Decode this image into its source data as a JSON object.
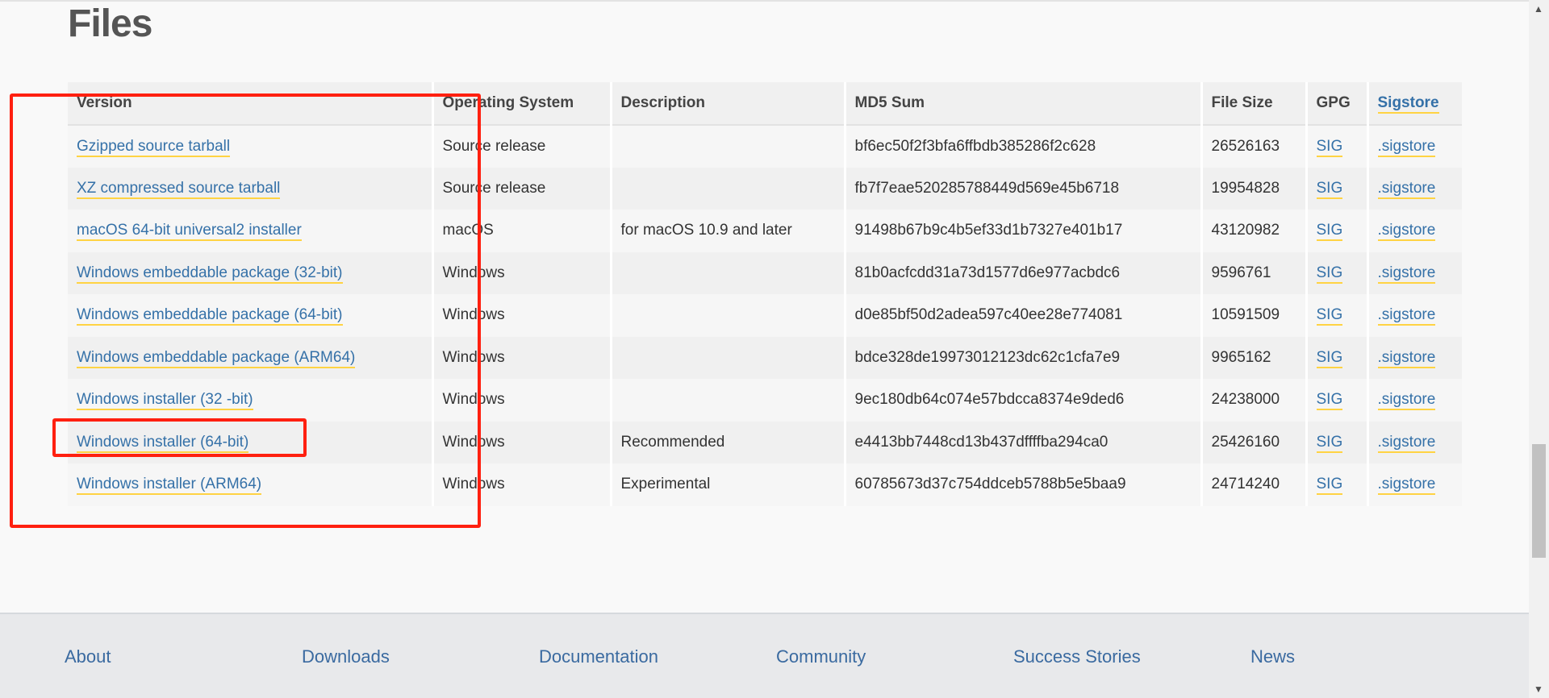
{
  "title": "Files",
  "columns": [
    "Version",
    "Operating System",
    "Description",
    "MD5 Sum",
    "File Size",
    "GPG",
    "Sigstore"
  ],
  "rows": [
    {
      "version": "Gzipped source tarball",
      "os": "Source release",
      "description": "",
      "md5": "bf6ec50f2f3bfa6ffbdb385286f2c628",
      "size": "26526163",
      "gpg": "SIG",
      "sigstore": ".sigstore"
    },
    {
      "version": "XZ compressed source tarball",
      "os": "Source release",
      "description": "",
      "md5": "fb7f7eae520285788449d569e45b6718",
      "size": "19954828",
      "gpg": "SIG",
      "sigstore": ".sigstore"
    },
    {
      "version": "macOS 64-bit universal2 installer",
      "os": "macOS",
      "description": "for macOS 10.9 and later",
      "md5": "91498b67b9c4b5ef33d1b7327e401b17",
      "size": "43120982",
      "gpg": "SIG",
      "sigstore": ".sigstore"
    },
    {
      "version": "Windows embeddable package (32-bit)",
      "os": "Windows",
      "description": "",
      "md5": "81b0acfcdd31a73d1577d6e977acbdc6",
      "size": "9596761",
      "gpg": "SIG",
      "sigstore": ".sigstore"
    },
    {
      "version": "Windows embeddable package (64-bit)",
      "os": "Windows",
      "description": "",
      "md5": "d0e85bf50d2adea597c40ee28e774081",
      "size": "10591509",
      "gpg": "SIG",
      "sigstore": ".sigstore"
    },
    {
      "version": "Windows embeddable package (ARM64)",
      "os": "Windows",
      "description": "",
      "md5": "bdce328de19973012123dc62c1cfa7e9",
      "size": "9965162",
      "gpg": "SIG",
      "sigstore": ".sigstore"
    },
    {
      "version": "Windows installer (32 -bit)",
      "os": "Windows",
      "description": "",
      "md5": "9ec180db64c074e57bdcca8374e9ded6",
      "size": "24238000",
      "gpg": "SIG",
      "sigstore": ".sigstore"
    },
    {
      "version": "Windows installer (64-bit)",
      "os": "Windows",
      "description": "Recommended",
      "md5": "e4413bb7448cd13b437dffffba294ca0",
      "size": "25426160",
      "gpg": "SIG",
      "sigstore": ".sigstore"
    },
    {
      "version": "Windows installer (ARM64)",
      "os": "Windows",
      "description": "Experimental",
      "md5": "60785673d37c754ddceb5788b5e5baa9",
      "size": "24714240",
      "gpg": "SIG",
      "sigstore": ".sigstore"
    }
  ],
  "footer": [
    "About",
    "Downloads",
    "Documentation",
    "Community",
    "Success Stories",
    "News"
  ],
  "colors": {
    "link": "#3571a8",
    "underline": "#ffd343",
    "annotation": "#ff2010"
  }
}
